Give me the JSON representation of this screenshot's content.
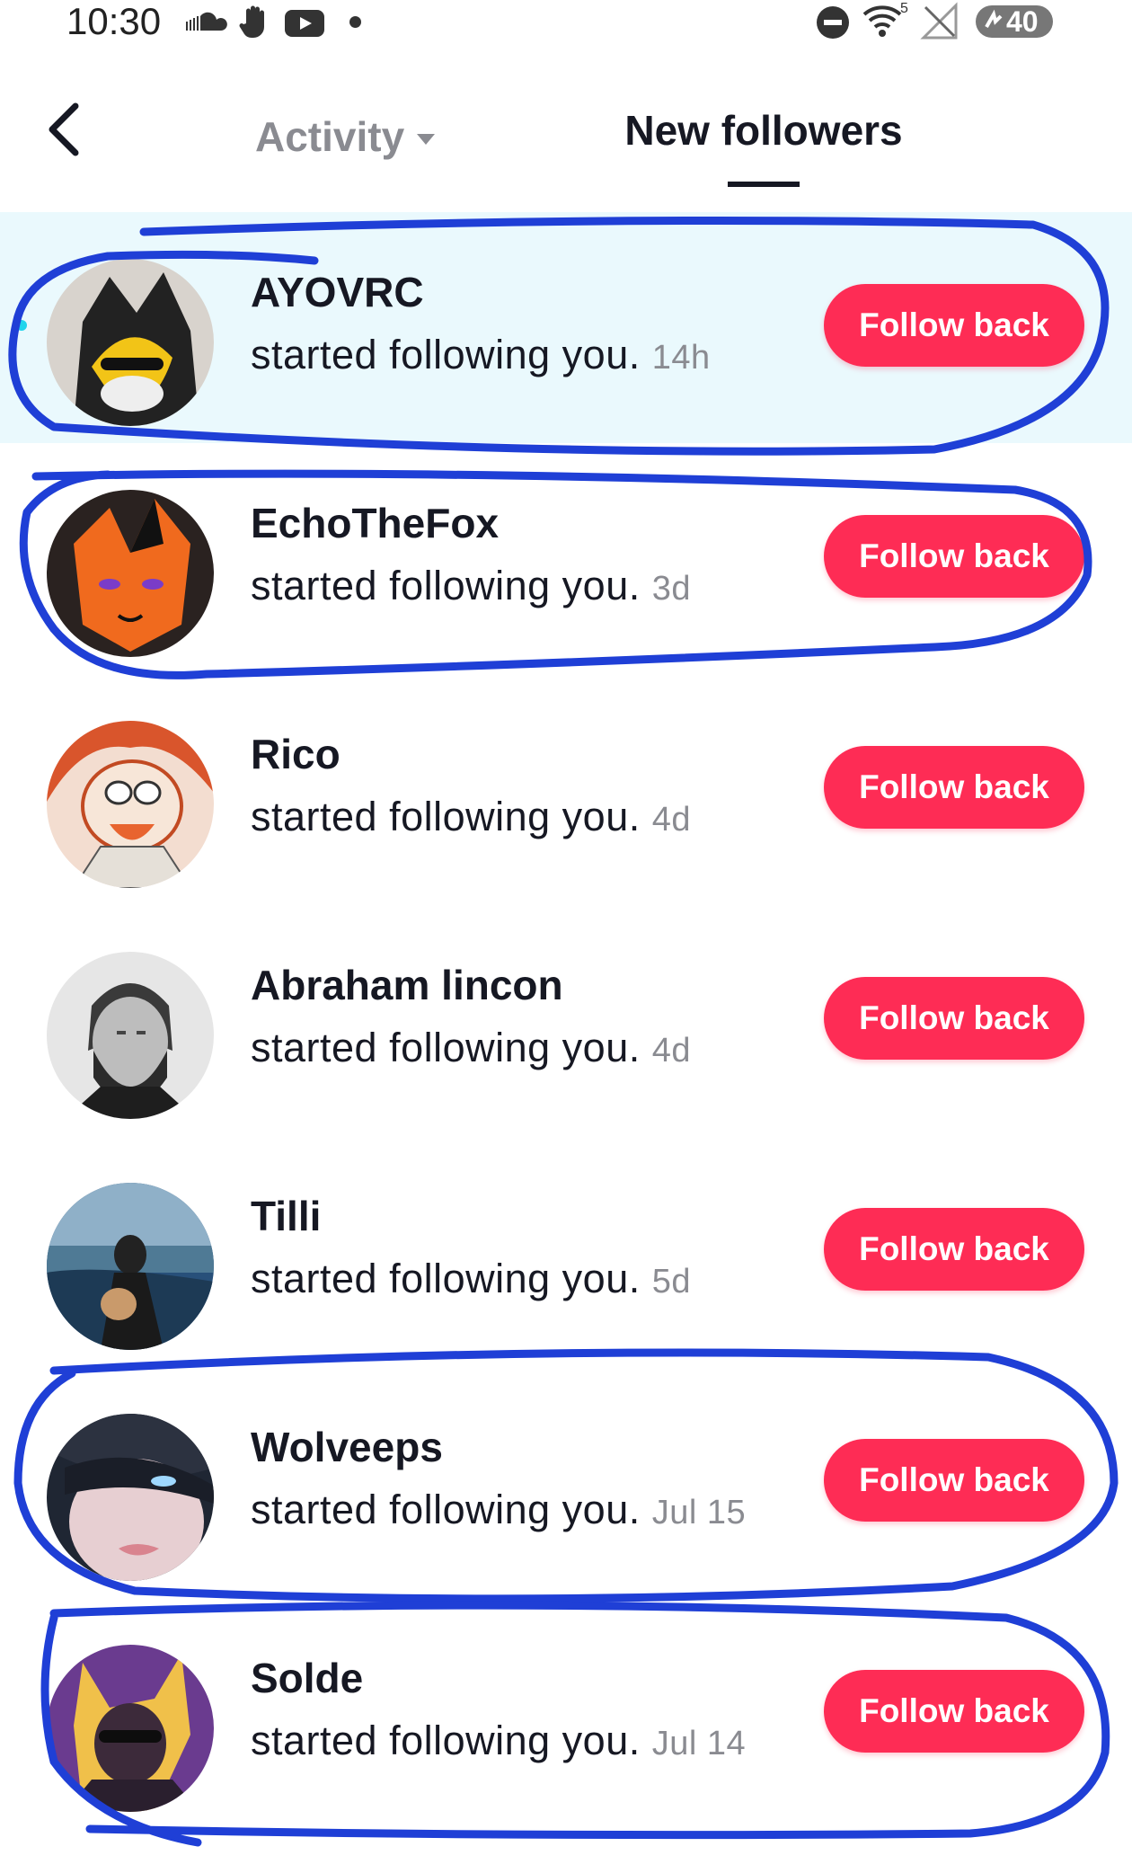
{
  "status_bar": {
    "time": "10:30",
    "battery": "40",
    "icons": [
      "soundcloud-icon",
      "hand-icon",
      "youtube-icon",
      "dot-icon",
      "do-not-disturb-icon",
      "wifi-icon",
      "signal-off-icon",
      "battery-icon"
    ]
  },
  "header": {
    "back_icon": "chevron-left-icon",
    "activity_label": "Activity",
    "new_followers_label": "New followers"
  },
  "followers": [
    {
      "name": "AYOVRC",
      "text": "started following you.",
      "time": "14h",
      "button": "Follow back",
      "unread": true
    },
    {
      "name": "EchoTheFox",
      "text": "started following you.",
      "time": "3d",
      "button": "Follow back"
    },
    {
      "name": "Rico",
      "text": "started following you.",
      "time": "4d",
      "button": "Follow back"
    },
    {
      "name": "Abraham lincon",
      "text": "started following you.",
      "time": "4d",
      "button": "Follow back"
    },
    {
      "name": "Tilli",
      "text": "started following you.",
      "time": "5d",
      "button": "Follow back"
    },
    {
      "name": "Wolveeps",
      "text": "started following you.",
      "time": "Jul 15",
      "button": "Follow back"
    },
    {
      "name": "Solde",
      "text": "started following you.",
      "time": "Jul 14",
      "button": "Follow back"
    }
  ],
  "colors": {
    "accent": "#fe2c55",
    "highlight_row": "#eaf9fd",
    "marker": "#1f3fd6",
    "muted_text": "#8a8b91"
  }
}
